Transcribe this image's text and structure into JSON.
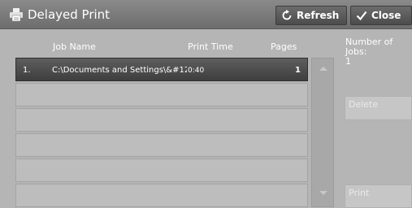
{
  "titlebar": {
    "title": "Delayed Print",
    "icon": "printer-icon",
    "refresh_label": "Refresh",
    "close_label": "Close"
  },
  "table": {
    "headers": {
      "job_name": "Job Name",
      "print_time": "Print Time",
      "pages": "Pages"
    },
    "rows": [
      {
        "num": "1.",
        "name": "C:\\Documents and Settings\\&#12",
        "time": "0:40",
        "pages": "1"
      },
      {
        "num": "",
        "name": "",
        "time": "",
        "pages": ""
      },
      {
        "num": "",
        "name": "",
        "time": "",
        "pages": ""
      },
      {
        "num": "",
        "name": "",
        "time": "",
        "pages": ""
      },
      {
        "num": "",
        "name": "",
        "time": "",
        "pages": ""
      },
      {
        "num": "",
        "name": "",
        "time": "",
        "pages": ""
      }
    ]
  },
  "side": {
    "num_jobs_label": "Number of Jobs:",
    "num_jobs_value": "1",
    "delete_label": "Delete",
    "print_label": "Print"
  },
  "colors": {
    "titlebar": "#6d6d6d",
    "selected_row": "#3e3e3e",
    "background": "#b5b5b5"
  }
}
